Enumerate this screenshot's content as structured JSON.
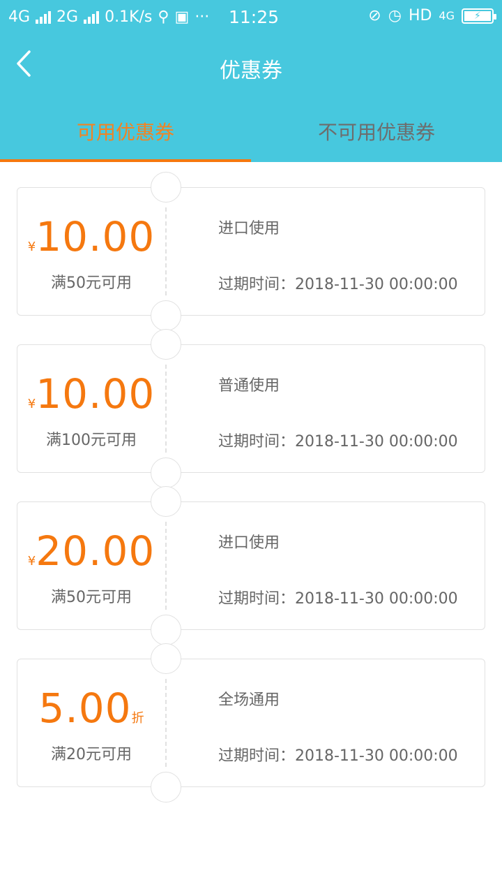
{
  "status_bar": {
    "net1": "4G",
    "net2": "2G",
    "speed": "0.1K/s",
    "time": "11:25",
    "hd": "HD",
    "net_right": "4G"
  },
  "header": {
    "title": "优惠券",
    "back_icon": "chevron-left-icon"
  },
  "tabs": [
    {
      "label": "可用优惠券",
      "active": true
    },
    {
      "label": "不可用优惠券",
      "active": false
    }
  ],
  "coupons": [
    {
      "currency": "¥",
      "amount": "10.00",
      "unit": "",
      "condition": "满50元可用",
      "type": "进口使用",
      "expiry": "过期时间：2018-11-30 00:00:00"
    },
    {
      "currency": "¥",
      "amount": "10.00",
      "unit": "",
      "condition": "满100元可用",
      "type": "普通使用",
      "expiry": "过期时间：2018-11-30 00:00:00"
    },
    {
      "currency": "¥",
      "amount": "20.00",
      "unit": "",
      "condition": "满50元可用",
      "type": "进口使用",
      "expiry": "过期时间：2018-11-30 00:00:00"
    },
    {
      "currency": "",
      "amount": "5.00",
      "unit": "折",
      "condition": "满20元可用",
      "type": "全场通用",
      "expiry": "过期时间：2018-11-30 00:00:00"
    }
  ],
  "colors": {
    "header_bg": "#47c8de",
    "accent": "#f5780f",
    "text_gray": "#666666",
    "border": "#e1e1e1"
  }
}
